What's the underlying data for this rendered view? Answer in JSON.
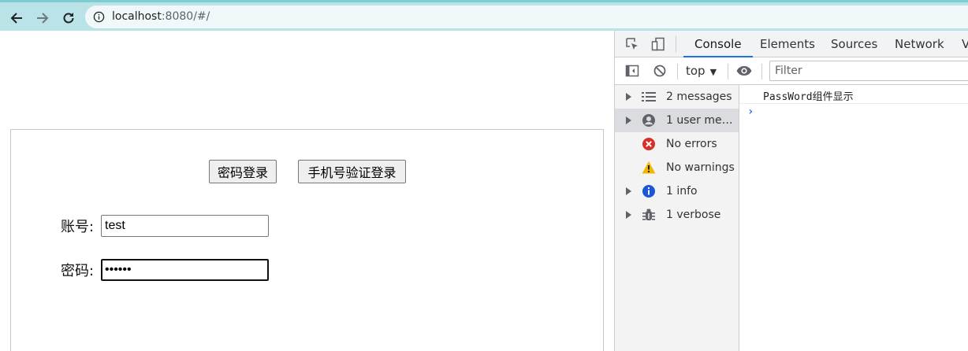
{
  "browser": {
    "url_host": "localhost",
    "url_rest": ":8080/#/"
  },
  "login": {
    "tab_password": "密码登录",
    "tab_sms": "手机号验证登录",
    "account_label": "账号:",
    "account_value": "test",
    "password_label": "密码:",
    "password_mask": "••••••"
  },
  "devtools": {
    "tabs": [
      {
        "label": "Console",
        "active": true
      },
      {
        "label": "Elements"
      },
      {
        "label": "Sources"
      },
      {
        "label": "Network"
      },
      {
        "label": "V"
      }
    ],
    "context": "top",
    "filter_placeholder": "Filter",
    "sidebar": [
      {
        "label": "2 messages",
        "icon": "list-icon",
        "expandable": true
      },
      {
        "label": "1 user mess…",
        "icon": "user-icon",
        "expandable": true,
        "selected": true
      },
      {
        "label": "No errors",
        "icon": "error-icon",
        "color": "#d93025"
      },
      {
        "label": "No warnings",
        "icon": "warning-icon",
        "color": "#f2b600"
      },
      {
        "label": "1 info",
        "icon": "info-icon",
        "color": "#1a73e8",
        "expandable": true
      },
      {
        "label": "1 verbose",
        "icon": "bug-icon",
        "expandable": true
      }
    ],
    "log": "PassWord组件显示",
    "prompt": "›"
  },
  "colors": {
    "toolbar": "#b9e3e6",
    "accent": "#1a73e8"
  }
}
